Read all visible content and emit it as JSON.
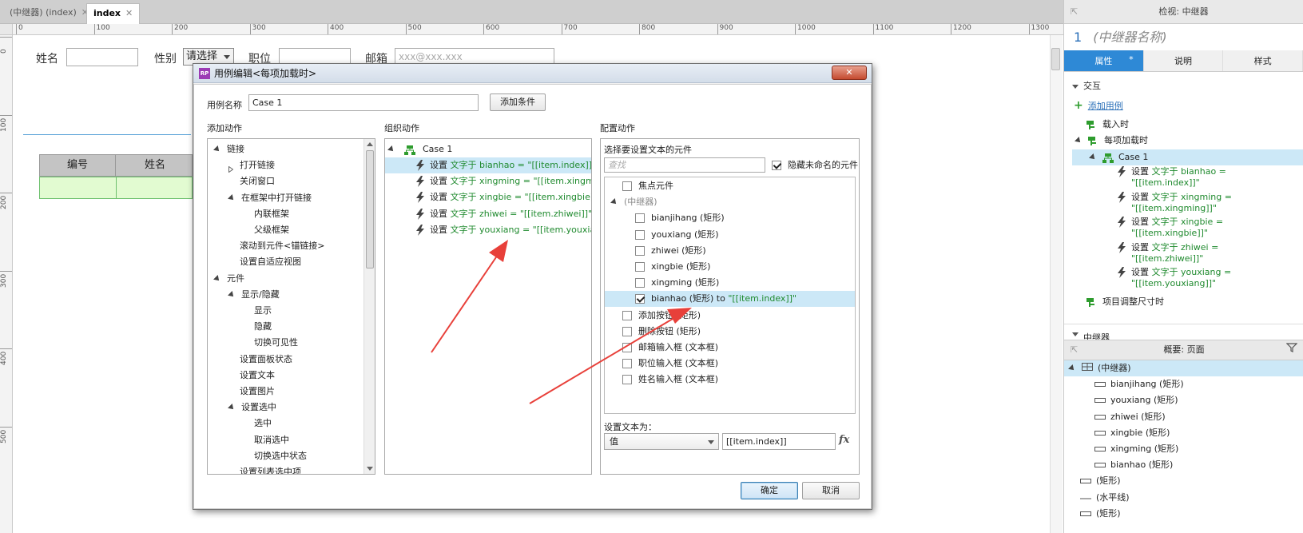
{
  "doc_tabs": [
    {
      "label": "(中继器) (index)",
      "close": "✕"
    },
    {
      "label": "index",
      "close": "✕"
    }
  ],
  "ruler_h": [
    "0",
    "100",
    "200",
    "300",
    "400",
    "500",
    "600",
    "700",
    "800",
    "900",
    "1000",
    "1100",
    "1200",
    "1300"
  ],
  "ruler_v": [
    "0",
    "100",
    "200",
    "300",
    "400",
    "500"
  ],
  "canvas": {
    "label_name": "姓名",
    "label_gender": "性别",
    "gender_select": "请选择",
    "label_position": "职位",
    "label_email": "邮箱",
    "email_placeholder": "xxx@xxx.xxx",
    "table_headers": [
      "编号",
      "姓名"
    ]
  },
  "dialog": {
    "title": "用例编辑<每项加载时>",
    "close": "✕",
    "case_name_label": "用例名称",
    "case_name_value": "Case 1",
    "add_condition": "添加条件",
    "add_action_title": "添加动作",
    "organize_title": "组织动作",
    "configure_title": "配置动作",
    "action_tree": [
      {
        "label": "链接",
        "level": 0,
        "toggle": "open"
      },
      {
        "label": "打开链接",
        "level": 1,
        "toggle": "closed"
      },
      {
        "label": "关闭窗口",
        "level": 1,
        "toggle": "none"
      },
      {
        "label": "在框架中打开链接",
        "level": 1,
        "toggle": "open"
      },
      {
        "label": "内联框架",
        "level": 2,
        "toggle": "none"
      },
      {
        "label": "父级框架",
        "level": 2,
        "toggle": "none"
      },
      {
        "label": "滚动到元件<锚链接>",
        "level": 1,
        "toggle": "none"
      },
      {
        "label": "设置自适应视图",
        "level": 1,
        "toggle": "none"
      },
      {
        "label": "元件",
        "level": 0,
        "toggle": "open"
      },
      {
        "label": "显示/隐藏",
        "level": 1,
        "toggle": "open"
      },
      {
        "label": "显示",
        "level": 2,
        "toggle": "none"
      },
      {
        "label": "隐藏",
        "level": 2,
        "toggle": "none"
      },
      {
        "label": "切换可见性",
        "level": 2,
        "toggle": "none"
      },
      {
        "label": "设置面板状态",
        "level": 1,
        "toggle": "none"
      },
      {
        "label": "设置文本",
        "level": 1,
        "toggle": "none"
      },
      {
        "label": "设置图片",
        "level": 1,
        "toggle": "none"
      },
      {
        "label": "设置选中",
        "level": 1,
        "toggle": "open"
      },
      {
        "label": "选中",
        "level": 2,
        "toggle": "none"
      },
      {
        "label": "取消选中",
        "level": 2,
        "toggle": "none"
      },
      {
        "label": "切换选中状态",
        "level": 2,
        "toggle": "none"
      },
      {
        "label": "设置列表选中项",
        "level": 1,
        "toggle": "none"
      }
    ],
    "case_label": "Case 1",
    "actions": [
      {
        "verb": "设置",
        "text": "文字于 bianhao = \"[[item.index]]\""
      },
      {
        "verb": "设置",
        "text": "文字于 xingming = \"[[item.xingming]]\""
      },
      {
        "verb": "设置",
        "text": "文字于 xingbie = \"[[item.xingbie]]\""
      },
      {
        "verb": "设置",
        "text": "文字于 zhiwei = \"[[item.zhiwei]]\""
      },
      {
        "verb": "设置",
        "text": "文字于 youxiang = \"[[item.youxiang]]\""
      }
    ],
    "select_widget_label": "选择要设置文本的元件",
    "search_placeholder": "查找",
    "hide_unnamed_label": "隐藏未命名的元件",
    "widgets": [
      {
        "label": "焦点元件",
        "level": 0,
        "checked": false
      },
      {
        "label": "(中继器)",
        "level": 0,
        "group": true
      },
      {
        "label": "bianjihang (矩形)",
        "level": 1,
        "checked": false
      },
      {
        "label": "youxiang (矩形)",
        "level": 1,
        "checked": false
      },
      {
        "label": "zhiwei (矩形)",
        "level": 1,
        "checked": false
      },
      {
        "label": "xingbie (矩形)",
        "level": 1,
        "checked": false
      },
      {
        "label": "xingming (矩形)",
        "level": 1,
        "checked": false
      },
      {
        "label": "bianhao (矩形) to",
        "extra": "\"[[item.index]]\"",
        "level": 1,
        "checked": true
      },
      {
        "label": "添加按钮 (矩形)",
        "level": 0,
        "checked": false
      },
      {
        "label": "删除按钮 (矩形)",
        "level": 0,
        "checked": false
      },
      {
        "label": "邮箱输入框 (文本框)",
        "level": 0,
        "checked": false
      },
      {
        "label": "职位输入框 (文本框)",
        "level": 0,
        "checked": false
      },
      {
        "label": "姓名输入框 (文本框)",
        "level": 0,
        "checked": false
      }
    ],
    "set_text_label": "设置文本为：",
    "set_text_type": "值",
    "set_text_value": "[[item.index]]",
    "fx": "fx",
    "ok": "确定",
    "cancel": "取消"
  },
  "inspector": {
    "header": "检视: 中继器",
    "number": "1",
    "name_placeholder": "(中继器名称)",
    "tabs": [
      "属性",
      "说明",
      "样式"
    ],
    "tab_star": "*",
    "section_interaction": "交互",
    "add_case": "添加用例",
    "events": [
      {
        "label": "载入时",
        "level": 0
      },
      {
        "label": "每项加载时",
        "level": 0,
        "open": true
      },
      {
        "label": "Case 1",
        "level": 1,
        "case": true
      },
      {
        "label": "项目调整尺寸时",
        "level": 0
      }
    ],
    "event_actions": [
      {
        "verb": "设置",
        "line1": "文字于 bianhao =",
        "line2": "\"[[item.index]]\""
      },
      {
        "verb": "设置",
        "line1": "文字于 xingming =",
        "line2": "\"[[item.xingming]]\""
      },
      {
        "verb": "设置",
        "line1": "文字于 xingbie =",
        "line2": "\"[[item.xingbie]]\""
      },
      {
        "verb": "设置",
        "line1": "文字于 zhiwei =",
        "line2": "\"[[item.zhiwei]]\""
      },
      {
        "verb": "设置",
        "line1": "文字于 youxiang =",
        "line2": "\"[[item.youxiang]]\""
      }
    ],
    "section_repeater": "中继器"
  },
  "outline": {
    "header": "概要: 页面",
    "items": [
      {
        "label": "(中继器)",
        "level": 0,
        "type": "repeater"
      },
      {
        "label": "bianjihang (矩形)",
        "level": 1,
        "type": "rect"
      },
      {
        "label": "youxiang (矩形)",
        "level": 1,
        "type": "rect"
      },
      {
        "label": "zhiwei (矩形)",
        "level": 1,
        "type": "rect"
      },
      {
        "label": "xingbie (矩形)",
        "level": 1,
        "type": "rect"
      },
      {
        "label": "xingming (矩形)",
        "level": 1,
        "type": "rect"
      },
      {
        "label": "bianhao (矩形)",
        "level": 1,
        "type": "rect"
      },
      {
        "label": "(矩形)",
        "level": 0,
        "type": "rect"
      },
      {
        "label": "(水平线)",
        "level": 0,
        "type": "line"
      },
      {
        "label": "(矩形)",
        "level": 0,
        "type": "rect"
      }
    ]
  }
}
